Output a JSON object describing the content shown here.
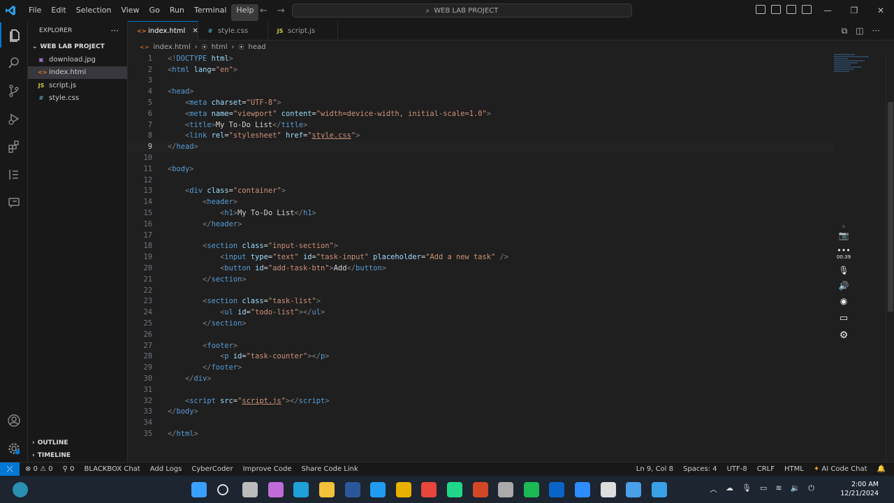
{
  "menu": [
    "File",
    "Edit",
    "Selection",
    "View",
    "Go",
    "Run",
    "Terminal",
    "Help"
  ],
  "search": {
    "text": "WEB LAB PROJECT"
  },
  "sidebar": {
    "title": "EXPLORER",
    "project": "WEB LAB PROJECT",
    "files": [
      {
        "name": "download.jpg",
        "kind": "image",
        "glyph": "▣",
        "color": "#a074c4"
      },
      {
        "name": "index.html",
        "kind": "html",
        "glyph": "<>",
        "color": "#e37933"
      },
      {
        "name": "script.js",
        "kind": "js",
        "glyph": "JS",
        "color": "#cbcb41"
      },
      {
        "name": "style.css",
        "kind": "css",
        "glyph": "#",
        "color": "#519aba"
      }
    ],
    "outline": "OUTLINE",
    "timeline": "TIMELINE"
  },
  "tabs": [
    {
      "label": "index.html",
      "glyph": "<>",
      "color": "#e37933",
      "active": true
    },
    {
      "label": "style.css",
      "glyph": "#",
      "color": "#519aba",
      "active": false
    },
    {
      "label": "script.js",
      "glyph": "JS",
      "color": "#cbcb41",
      "active": false
    }
  ],
  "breadcrumb": [
    "index.html",
    "html",
    "head"
  ],
  "editor": {
    "current_line": 9,
    "lines": [
      [
        [
          "tag",
          "<!"
        ],
        [
          "name",
          "DOCTYPE"
        ],
        [
          "txt",
          " "
        ],
        [
          "attr",
          "html"
        ],
        [
          "tag",
          ">"
        ]
      ],
      [
        [
          "tag",
          "<"
        ],
        [
          "name",
          "html"
        ],
        [
          "txt",
          " "
        ],
        [
          "attr",
          "lang"
        ],
        [
          "txt",
          "="
        ],
        [
          "str",
          "\"en\""
        ],
        [
          "tag",
          ">"
        ]
      ],
      [],
      [
        [
          "tag",
          "<"
        ],
        [
          "name",
          "head"
        ],
        [
          "tag",
          ">"
        ]
      ],
      [
        [
          "txt",
          "    "
        ],
        [
          "tag",
          "<"
        ],
        [
          "name",
          "meta"
        ],
        [
          "txt",
          " "
        ],
        [
          "attr",
          "charset"
        ],
        [
          "txt",
          "="
        ],
        [
          "str",
          "\"UTF-8\""
        ],
        [
          "tag",
          ">"
        ]
      ],
      [
        [
          "txt",
          "    "
        ],
        [
          "tag",
          "<"
        ],
        [
          "name",
          "meta"
        ],
        [
          "txt",
          " "
        ],
        [
          "attr",
          "name"
        ],
        [
          "txt",
          "="
        ],
        [
          "str",
          "\"viewport\""
        ],
        [
          "txt",
          " "
        ],
        [
          "attr",
          "content"
        ],
        [
          "txt",
          "="
        ],
        [
          "str",
          "\"width=device-width, initial-scale=1.0\""
        ],
        [
          "tag",
          ">"
        ]
      ],
      [
        [
          "txt",
          "    "
        ],
        [
          "tag",
          "<"
        ],
        [
          "name",
          "title"
        ],
        [
          "tag",
          ">"
        ],
        [
          "txt",
          "My To-Do List"
        ],
        [
          "tag",
          "</"
        ],
        [
          "name",
          "title"
        ],
        [
          "tag",
          ">"
        ]
      ],
      [
        [
          "txt",
          "    "
        ],
        [
          "tag",
          "<"
        ],
        [
          "name",
          "link"
        ],
        [
          "txt",
          " "
        ],
        [
          "attr",
          "rel"
        ],
        [
          "txt",
          "="
        ],
        [
          "str",
          "\"stylesheet\""
        ],
        [
          "txt",
          " "
        ],
        [
          "attr",
          "href"
        ],
        [
          "txt",
          "="
        ],
        [
          "str",
          "\""
        ],
        [
          "stru",
          "style.css"
        ],
        [
          "str",
          "\""
        ],
        [
          "tag",
          ">"
        ]
      ],
      [
        [
          "tag",
          "</"
        ],
        [
          "name",
          "head"
        ],
        [
          "tag",
          ">"
        ]
      ],
      [],
      [
        [
          "tag",
          "<"
        ],
        [
          "name",
          "body"
        ],
        [
          "tag",
          ">"
        ]
      ],
      [],
      [
        [
          "txt",
          "    "
        ],
        [
          "tag",
          "<"
        ],
        [
          "name",
          "div"
        ],
        [
          "txt",
          " "
        ],
        [
          "attr",
          "class"
        ],
        [
          "txt",
          "="
        ],
        [
          "str",
          "\"container\""
        ],
        [
          "tag",
          ">"
        ]
      ],
      [
        [
          "txt",
          "        "
        ],
        [
          "tag",
          "<"
        ],
        [
          "name",
          "header"
        ],
        [
          "tag",
          ">"
        ]
      ],
      [
        [
          "txt",
          "            "
        ],
        [
          "tag",
          "<"
        ],
        [
          "name",
          "h1"
        ],
        [
          "tag",
          ">"
        ],
        [
          "txt",
          "My To-Do List"
        ],
        [
          "tag",
          "</"
        ],
        [
          "name",
          "h1"
        ],
        [
          "tag",
          ">"
        ]
      ],
      [
        [
          "txt",
          "        "
        ],
        [
          "tag",
          "</"
        ],
        [
          "name",
          "header"
        ],
        [
          "tag",
          ">"
        ]
      ],
      [],
      [
        [
          "txt",
          "        "
        ],
        [
          "tag",
          "<"
        ],
        [
          "name",
          "section"
        ],
        [
          "txt",
          " "
        ],
        [
          "attr",
          "class"
        ],
        [
          "txt",
          "="
        ],
        [
          "str",
          "\"input-section\""
        ],
        [
          "tag",
          ">"
        ]
      ],
      [
        [
          "txt",
          "            "
        ],
        [
          "tag",
          "<"
        ],
        [
          "name",
          "input"
        ],
        [
          "txt",
          " "
        ],
        [
          "attr",
          "type"
        ],
        [
          "txt",
          "="
        ],
        [
          "str",
          "\"text\""
        ],
        [
          "txt",
          " "
        ],
        [
          "attr",
          "id"
        ],
        [
          "txt",
          "="
        ],
        [
          "str",
          "\"task-input\""
        ],
        [
          "txt",
          " "
        ],
        [
          "attr",
          "placeholder"
        ],
        [
          "txt",
          "="
        ],
        [
          "str",
          "\"Add a new task\""
        ],
        [
          "txt",
          " "
        ],
        [
          "tag",
          "/>"
        ]
      ],
      [
        [
          "txt",
          "            "
        ],
        [
          "tag",
          "<"
        ],
        [
          "name",
          "button"
        ],
        [
          "txt",
          " "
        ],
        [
          "attr",
          "id"
        ],
        [
          "txt",
          "="
        ],
        [
          "str",
          "\"add-task-btn\""
        ],
        [
          "tag",
          ">"
        ],
        [
          "txt",
          "Add"
        ],
        [
          "tag",
          "</"
        ],
        [
          "name",
          "button"
        ],
        [
          "tag",
          ">"
        ]
      ],
      [
        [
          "txt",
          "        "
        ],
        [
          "tag",
          "</"
        ],
        [
          "name",
          "section"
        ],
        [
          "tag",
          ">"
        ]
      ],
      [],
      [
        [
          "txt",
          "        "
        ],
        [
          "tag",
          "<"
        ],
        [
          "name",
          "section"
        ],
        [
          "txt",
          " "
        ],
        [
          "attr",
          "class"
        ],
        [
          "txt",
          "="
        ],
        [
          "str",
          "\"task-list\""
        ],
        [
          "tag",
          ">"
        ]
      ],
      [
        [
          "txt",
          "            "
        ],
        [
          "tag",
          "<"
        ],
        [
          "name",
          "ul"
        ],
        [
          "txt",
          " "
        ],
        [
          "attr",
          "id"
        ],
        [
          "txt",
          "="
        ],
        [
          "str",
          "\"todo-list\""
        ],
        [
          "tag",
          "></"
        ],
        [
          "name",
          "ul"
        ],
        [
          "tag",
          ">"
        ]
      ],
      [
        [
          "txt",
          "        "
        ],
        [
          "tag",
          "</"
        ],
        [
          "name",
          "section"
        ],
        [
          "tag",
          ">"
        ]
      ],
      [],
      [
        [
          "txt",
          "        "
        ],
        [
          "tag",
          "<"
        ],
        [
          "name",
          "footer"
        ],
        [
          "tag",
          ">"
        ]
      ],
      [
        [
          "txt",
          "            "
        ],
        [
          "tag",
          "<"
        ],
        [
          "name",
          "p"
        ],
        [
          "txt",
          " "
        ],
        [
          "attr",
          "id"
        ],
        [
          "txt",
          "="
        ],
        [
          "str",
          "\"task-counter\""
        ],
        [
          "tag",
          "></"
        ],
        [
          "name",
          "p"
        ],
        [
          "tag",
          ">"
        ]
      ],
      [
        [
          "txt",
          "        "
        ],
        [
          "tag",
          "</"
        ],
        [
          "name",
          "footer"
        ],
        [
          "tag",
          ">"
        ]
      ],
      [
        [
          "txt",
          "    "
        ],
        [
          "tag",
          "</"
        ],
        [
          "name",
          "div"
        ],
        [
          "tag",
          ">"
        ]
      ],
      [],
      [
        [
          "txt",
          "    "
        ],
        [
          "tag",
          "<"
        ],
        [
          "name",
          "script"
        ],
        [
          "txt",
          " "
        ],
        [
          "attr",
          "src"
        ],
        [
          "txt",
          "="
        ],
        [
          "str",
          "\""
        ],
        [
          "stru",
          "script.js"
        ],
        [
          "str",
          "\""
        ],
        [
          "tag",
          "></"
        ],
        [
          "name",
          "script"
        ],
        [
          "tag",
          ">"
        ]
      ],
      [
        [
          "tag",
          "</"
        ],
        [
          "name",
          "body"
        ],
        [
          "tag",
          ">"
        ]
      ],
      [],
      [
        [
          "tag",
          "</"
        ],
        [
          "name",
          "html"
        ],
        [
          "tag",
          ">"
        ]
      ]
    ]
  },
  "recorder": {
    "timer": "00:39"
  },
  "statusbar": {
    "errors": "0",
    "warnings": "0",
    "ports": "0",
    "left_items": [
      "BLACKBOX Chat",
      "Add Logs",
      "CyberCoder",
      "Improve Code",
      "Share Code Link"
    ],
    "position": "Ln 9, Col 8",
    "spaces": "Spaces: 4",
    "encoding": "UTF-8",
    "eol": "CRLF",
    "language": "HTML",
    "ai": "AI Code Chat"
  },
  "taskbar": {
    "time": "2:00 AM",
    "date": "12/21/2024",
    "apps": [
      {
        "name": "windows-start",
        "color": "#3aa0ff"
      },
      {
        "name": "search",
        "color": "#dddddd"
      },
      {
        "name": "task-view",
        "color": "#bbbbbb"
      },
      {
        "name": "copilot",
        "color": "#c16bd8"
      },
      {
        "name": "edge",
        "color": "#1fa0d8"
      },
      {
        "name": "file-explorer",
        "color": "#f3c13a"
      },
      {
        "name": "word",
        "color": "#2b579a"
      },
      {
        "name": "vscode",
        "color": "#1f9cf0"
      },
      {
        "name": "app-yellow",
        "color": "#e8b100"
      },
      {
        "name": "chrome",
        "color": "#e8453c"
      },
      {
        "name": "pycharm",
        "color": "#21d789"
      },
      {
        "name": "powerpoint",
        "color": "#d24726"
      },
      {
        "name": "store",
        "color": "#aaaaaa"
      },
      {
        "name": "spotify",
        "color": "#1db954"
      },
      {
        "name": "outlook",
        "color": "#0a64c8"
      },
      {
        "name": "zoom",
        "color": "#2d8cff"
      },
      {
        "name": "snipping",
        "color": "#dddddd"
      },
      {
        "name": "remote",
        "color": "#4aa0e8"
      },
      {
        "name": "photos",
        "color": "#3aa0e8"
      }
    ]
  }
}
